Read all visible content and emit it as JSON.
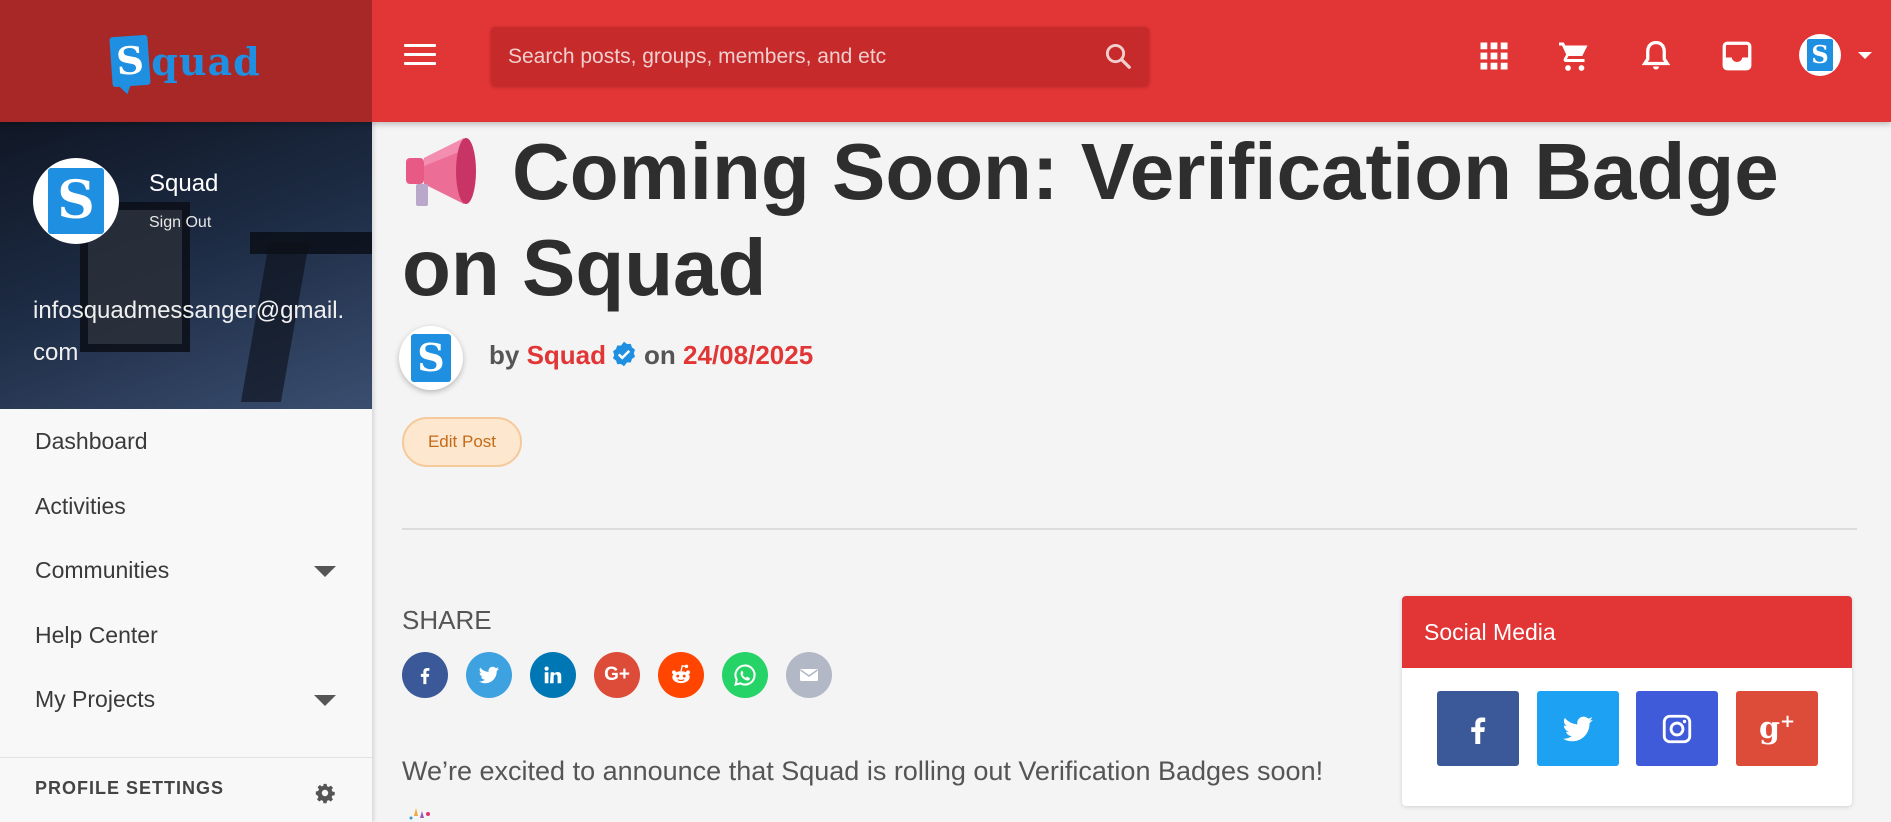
{
  "brand": {
    "logo_letter": "S",
    "logo_text": "quad",
    "accent": "#e23535",
    "dark_accent": "#a82828"
  },
  "header": {
    "search_placeholder": "Search posts, groups, members, and etc",
    "icons": [
      "menu-icon",
      "search-icon",
      "apps-grid-icon",
      "cart-icon",
      "bell-icon",
      "inbox-icon",
      "user-avatar",
      "chevron-down-icon"
    ]
  },
  "sidebar": {
    "profile": {
      "name": "Squad",
      "sign_out": "Sign Out",
      "email": "infosquadmessanger@gmail.com",
      "avatar_letter": "S"
    },
    "items": [
      {
        "label": "Dashboard"
      },
      {
        "label": "Activities"
      },
      {
        "label": "Communities"
      },
      {
        "label": "Help Center"
      },
      {
        "label": "My Projects"
      }
    ],
    "profile_settings": "PROFILE SETTINGS"
  },
  "post": {
    "title": "Coming Soon: Verification Badge on Squad",
    "by": "by",
    "author": "Squad",
    "on": "on",
    "date": "24/08/2025",
    "edit_label": "Edit Post",
    "share_label": "SHARE",
    "share_icons": [
      "facebook",
      "twitter",
      "linkedin",
      "google-plus",
      "reddit",
      "whatsapp",
      "email"
    ],
    "body": "We’re excited to announce that Squad is rolling out Verification Badges soon!"
  },
  "social_media": {
    "title": "Social Media",
    "icons": [
      "facebook",
      "twitter",
      "instagram",
      "google-plus"
    ]
  }
}
